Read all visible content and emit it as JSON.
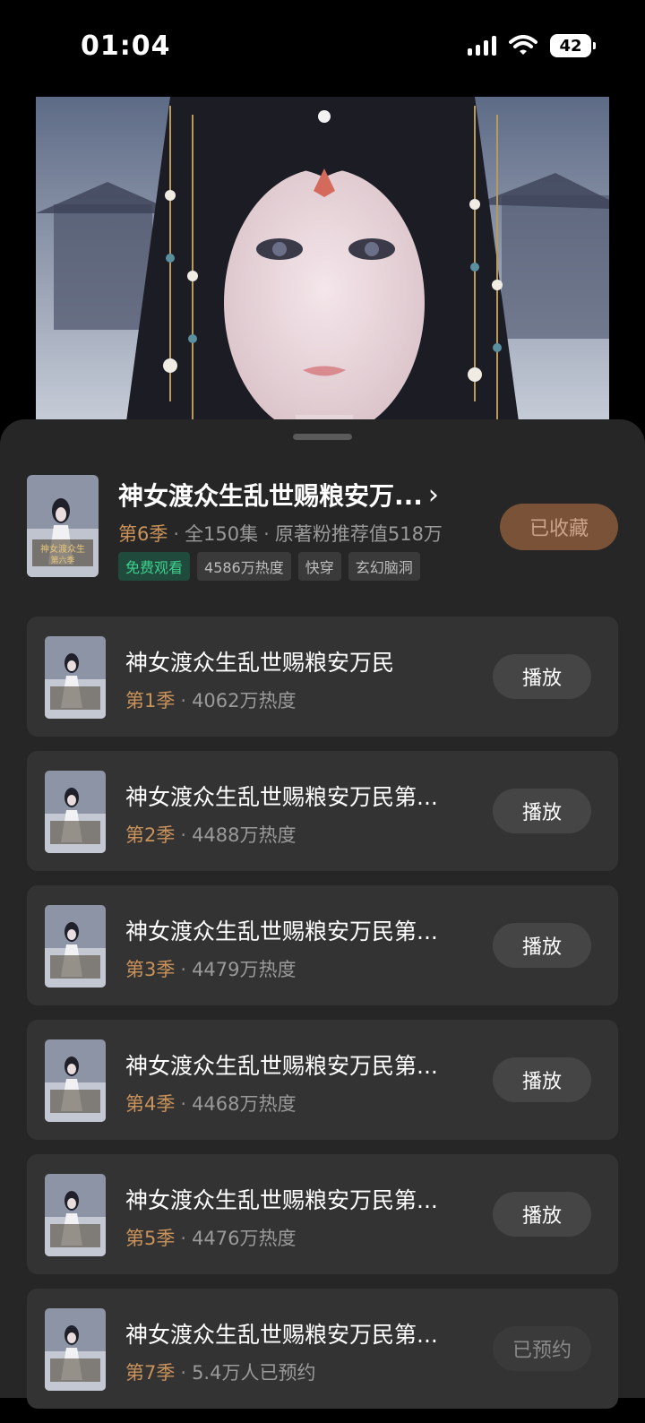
{
  "status_bar": {
    "time": "01:04",
    "battery": "42"
  },
  "main": {
    "title": "神女渡众生乱世赐粮安万...",
    "season": "第6季",
    "episodes": "全150集",
    "recommend": "原著粉推荐值518万",
    "tags": [
      "免费观看",
      "4586万热度",
      "快穿",
      "玄幻脑洞"
    ],
    "collect_label": "已收藏"
  },
  "seasons": [
    {
      "title": "神女渡众生乱世赐粮安万民",
      "season": "第1季",
      "stat": "4062万热度",
      "action": "播放"
    },
    {
      "title": "神女渡众生乱世赐粮安万民第...",
      "season": "第2季",
      "stat": "4488万热度",
      "action": "播放"
    },
    {
      "title": "神女渡众生乱世赐粮安万民第...",
      "season": "第3季",
      "stat": "4479万热度",
      "action": "播放"
    },
    {
      "title": "神女渡众生乱世赐粮安万民第...",
      "season": "第4季",
      "stat": "4468万热度",
      "action": "播放"
    },
    {
      "title": "神女渡众生乱世赐粮安万民第...",
      "season": "第5季",
      "stat": "4476万热度",
      "action": "播放"
    },
    {
      "title": "神女渡众生乱世赐粮安万民第...",
      "season": "第7季",
      "stat": "5.4万人已预约",
      "action": "已预约"
    }
  ],
  "colors": {
    "accent": "#c9925a",
    "collect_bg": "#7a5238",
    "free_tag": "#3fcf8e"
  }
}
